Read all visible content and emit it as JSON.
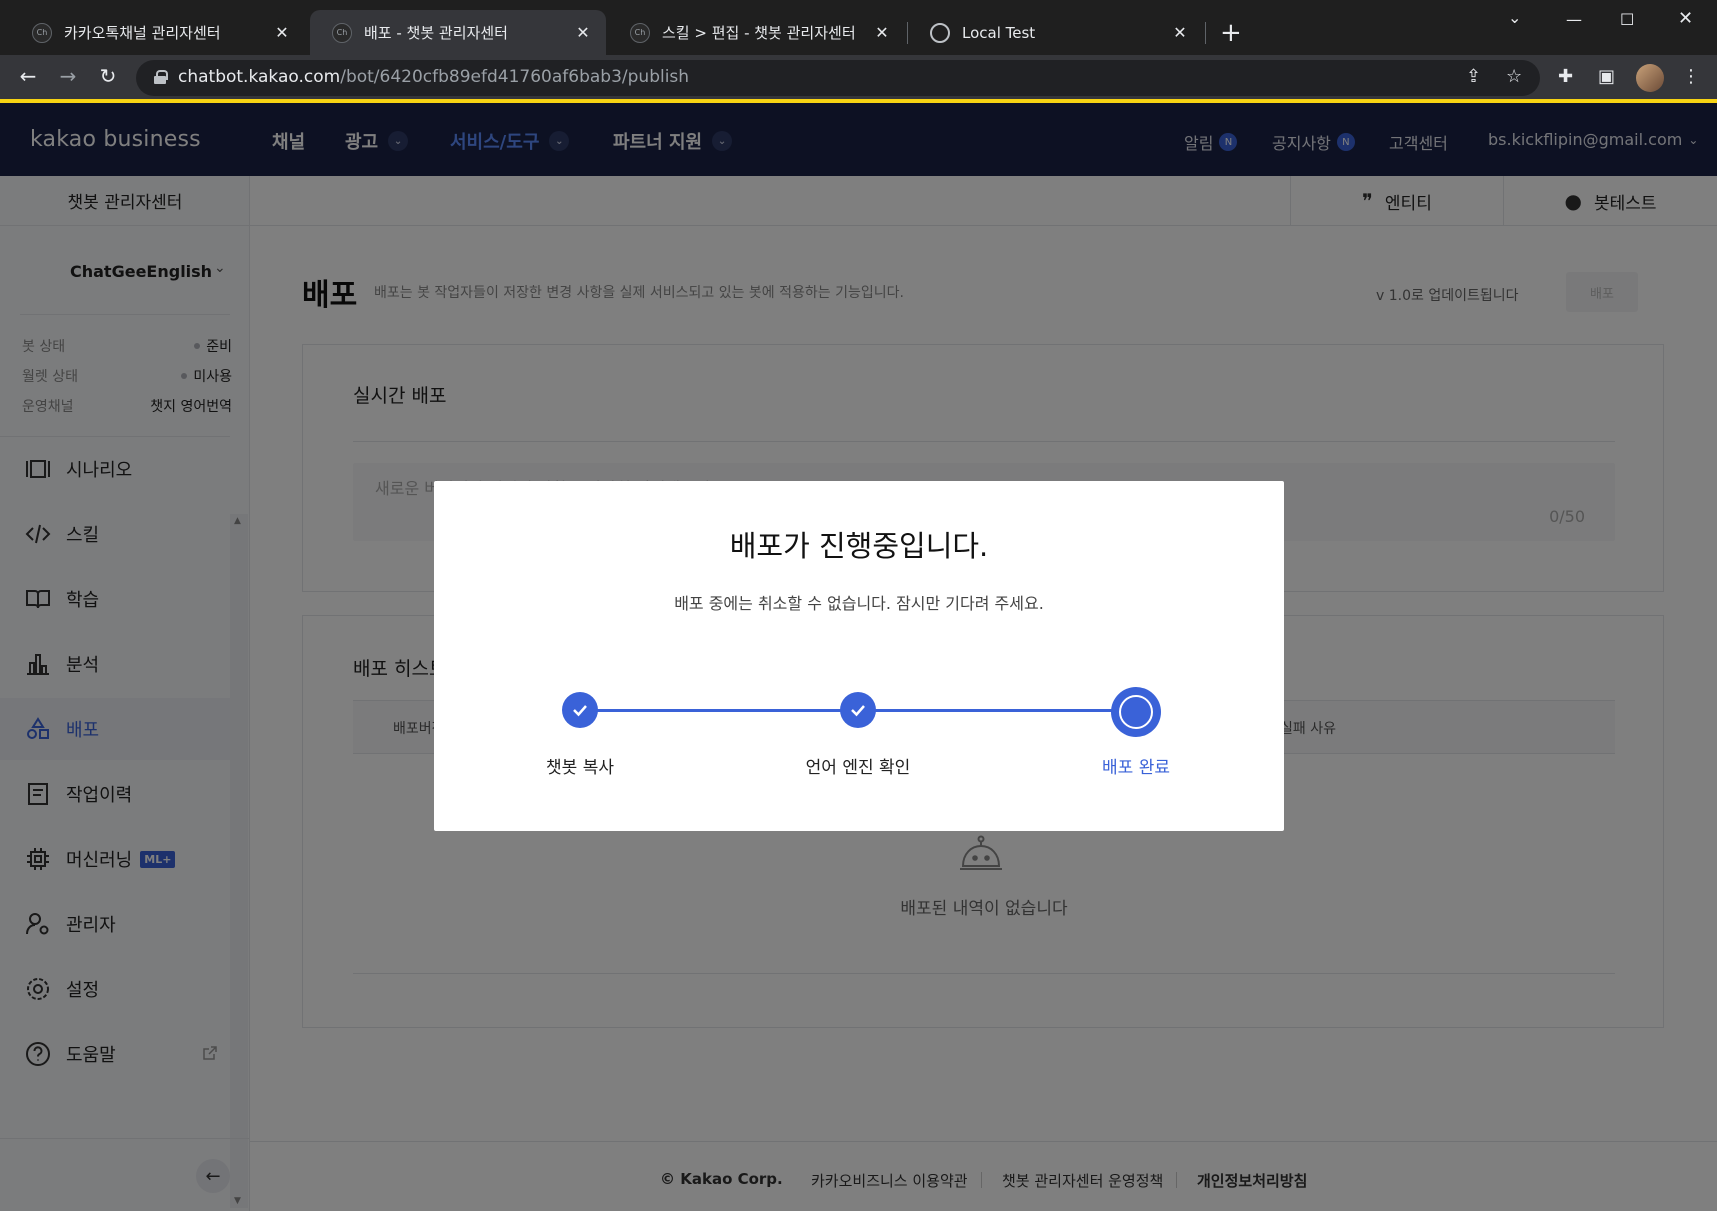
{
  "browser": {
    "tabs": [
      {
        "title": "카카오톡채널 관리자센터",
        "favicon": "chatbot-favicon",
        "active": false
      },
      {
        "title": "배포 - 챗봇 관리자센터",
        "favicon": "chatbot-favicon",
        "active": true
      },
      {
        "title": "스킬 > 편집 - 챗봇 관리자센터",
        "favicon": "chatbot-favicon",
        "active": false
      },
      {
        "title": "Local Test",
        "favicon": "globe-icon",
        "active": false
      }
    ],
    "favicon_text": "Ch",
    "address": {
      "domain": "chatbot.kakao.com",
      "path": "/bot/6420cfb89efd41760af6bab3/publish"
    }
  },
  "header": {
    "logo": "kakao business",
    "nav": [
      {
        "label": "채널",
        "has_caret": false,
        "active": false
      },
      {
        "label": "광고",
        "has_caret": true,
        "active": false
      },
      {
        "label": "서비스/도구",
        "has_caret": true,
        "active": true
      },
      {
        "label": "파트너 지원",
        "has_caret": true,
        "active": false
      }
    ],
    "right": {
      "alerts": "알림",
      "notices": "공지사항",
      "badge": "N",
      "support": "고객센터",
      "account": "bs.kickflipin@gmail.com"
    }
  },
  "sidebar": {
    "title": "챗봇 관리자센터",
    "bot_name": "ChatGeeEnglish",
    "status": [
      {
        "key": "봇 상태",
        "value": "준비",
        "dot": true
      },
      {
        "key": "월렛 상태",
        "value": "미사용",
        "dot": true
      },
      {
        "key": "운영채널",
        "value": "챗지 영어번역",
        "dot": false
      }
    ],
    "menu": [
      {
        "label": "시나리오",
        "icon": "scenario-icon"
      },
      {
        "label": "스킬",
        "icon": "code-icon"
      },
      {
        "label": "학습",
        "icon": "book-icon"
      },
      {
        "label": "분석",
        "icon": "bar-chart-icon"
      },
      {
        "label": "배포",
        "icon": "deploy-icon",
        "active": true
      },
      {
        "label": "작업이력",
        "icon": "history-icon"
      },
      {
        "label": "머신러닝",
        "icon": "chip-icon",
        "badge": "ML+"
      },
      {
        "label": "관리자",
        "icon": "admin-icon"
      },
      {
        "label": "설정",
        "icon": "gear-icon"
      },
      {
        "label": "도움말",
        "icon": "help-icon",
        "external": true
      }
    ]
  },
  "subheader": {
    "entity": "엔티티",
    "bottest": "봇테스트"
  },
  "main": {
    "title": "배포",
    "description": "배포는 봇 작업자들이 저장한 변경 사항을 실제 서비스되고 있는 봇에 적용하는 기능입니다.",
    "version_text": "v 1.0로 업데이트됩니다",
    "deploy_button": "배포",
    "realtime": {
      "title": "실시간 배포",
      "placeholder": "새로운 버전에서 변경된 사항을 간략히 작성해주세요.",
      "counter": "0/50"
    },
    "history": {
      "title": "배포 히스토리",
      "col_first": "배포버전",
      "col_last": "실패 사유",
      "empty": "배포된 내역이 없습니다"
    }
  },
  "footer": {
    "copyright": "© Kakao Corp.",
    "terms": "카카오비즈니스 이용약관",
    "policy": "챗봇 관리자센터 운영정책",
    "privacy": "개인정보처리방침"
  },
  "modal": {
    "title": "배포가 진행중입니다.",
    "description": "배포 중에는 취소할 수 없습니다. 잠시만 기다려 주세요.",
    "steps": [
      {
        "label": "챗봇 복사",
        "state": "done"
      },
      {
        "label": "언어 엔진 확인",
        "state": "done"
      },
      {
        "label": "배포 완료",
        "state": "current"
      }
    ]
  },
  "colors": {
    "accent": "#3a62d8",
    "nav_bg": "#1b2347",
    "chrome_yellow": "#f7d313"
  }
}
